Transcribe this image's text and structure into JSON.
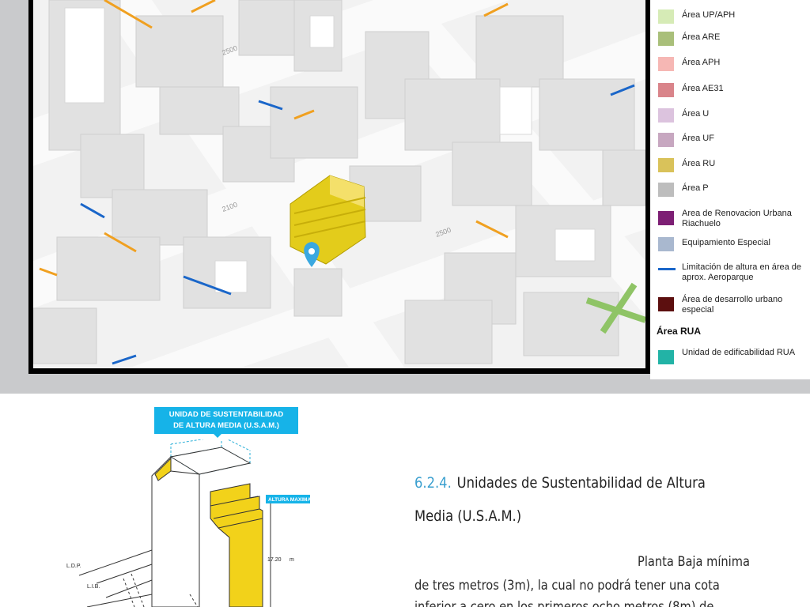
{
  "legend": {
    "items": [
      {
        "label": "Área UP/APH",
        "color": "#d6ebb6"
      },
      {
        "label": "Área ARE",
        "color": "#a9bf7a"
      },
      {
        "label": "Área APH",
        "color": "#f6b7b4"
      },
      {
        "label": "Área AE31",
        "color": "#d9848a"
      },
      {
        "label": "Área U",
        "color": "#dcc3de"
      },
      {
        "label": "Área UF",
        "color": "#c7a7c0"
      },
      {
        "label": "Área RU",
        "color": "#d9c25a"
      },
      {
        "label": "Área P",
        "color": "#bdbdbd"
      },
      {
        "label": "Area de Renovacion Urbana Riachuelo",
        "color": "#7d1f74"
      },
      {
        "label": "Equipamiento Especial",
        "color": "#a9b8cf"
      },
      {
        "label": "Limitación de altura en área de aprox. Aeroparque",
        "color": "#1a66c9"
      },
      {
        "label": "Área de desarrollo urbano especial",
        "color": "#5c0f0f"
      }
    ],
    "rua_heading": "Área RUA",
    "rua_item": {
      "label": "Unidad de edificabilidad RUA",
      "color": "#22b3a6"
    }
  },
  "map": {
    "street_labels": [
      "2500",
      "2100",
      "2500"
    ],
    "pin_color": "#3aa8e0",
    "highlight_color": "#e3cc1b"
  },
  "diagram": {
    "callout": "UNIDAD DE SUSTENTABILIDAD DE ALTURA MEDIA (U.S.A.M.)",
    "callout_line1": "UNIDAD DE SUSTENTABILIDAD",
    "callout_line2": "DE ALTURA MEDIA (U.S.A.M.)",
    "altura_maxima": "ALTURA MAXIMA",
    "height_value": "17.20",
    "height_unit": "m",
    "ldp": "L.D.P.",
    "lib": "L.I.B."
  },
  "section": {
    "number": "6.2.4.",
    "title_line1": "Unidades de Sustentabilidad de Altura",
    "title_line2": "Media (U.S.A.M.)",
    "para_line1": "Planta Baja mínima",
    "para_line2": "de tres metros (3m), la cual no podrá tener una cota",
    "para_line3": "inferior a cero en los primeros ocho metros (8m) de"
  }
}
